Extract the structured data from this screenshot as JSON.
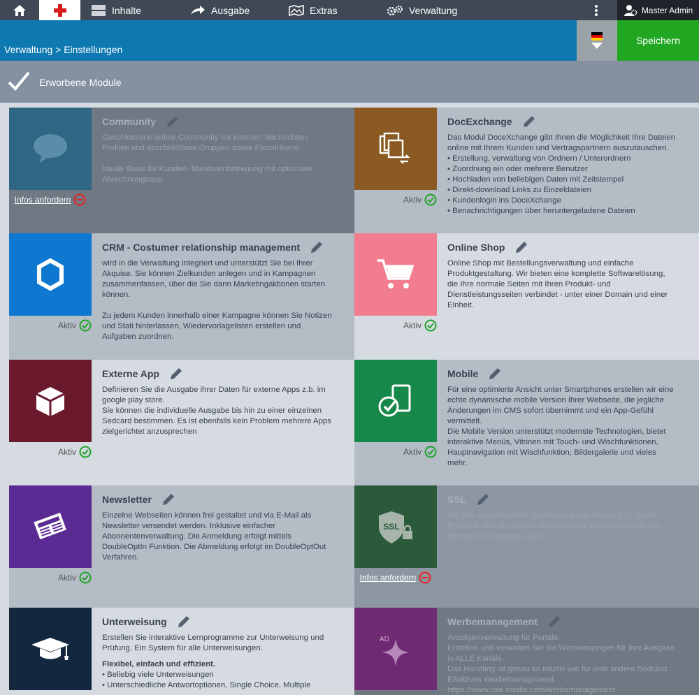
{
  "nav": {
    "inhalte": "Inhalte",
    "ausgabe": "Ausgabe",
    "extras": "Extras",
    "verwaltung": "Verwaltung",
    "admin": "Master Admin"
  },
  "header": {
    "breadcrumb": "Verwaltung > Einstellungen",
    "save_label": "Speichern"
  },
  "section": {
    "title": "Erworbene Module"
  },
  "labels": {
    "aktiv": "Aktiv",
    "infos": "Infos anfordern"
  },
  "colors": {
    "community": "#2f6683",
    "docexchange": "#8a5a22",
    "crm": "#0e78d0",
    "onlineshop": "#f27d8e",
    "externeapp": "#6b1a2e",
    "mobile": "#168849",
    "newsletter": "#5b2b94",
    "ssl": "#2a5a3a",
    "unterweisung": "#13273f",
    "werbemanagement": "#6e2a73"
  },
  "modules": {
    "community": {
      "name": "Community",
      "icon": "chat-bubble-icon",
      "status": "Infos anfordern",
      "desc": "Geschlossene online Community mit internen Nachrichten,\nProfilen und abschließbare Gruppen sowie Einzelräume.\n\nIdeale Basis für Kunden- Mandatenbetreuung mit optionaler\nAbrechnungsapp."
    },
    "docexchange": {
      "name": "DocExchange",
      "icon": "documents-exchange-icon",
      "status": "Aktiv",
      "desc": "Das Modul DoceXchange gibt Ihnen die Möglichkeit Ihre Dateien\nonline mit Ihrem Kunden und Vertragspartnern auszutauschen.\n• Erstellung, verwaltung von Ordnern / Unterordnern\n• Zuordnung ein oder mehrere Benutzer\n• Hochladen von beliebigen Daten mit Zeitstempel\n• Direkt-download Links zu Einzeldateien\n• Kundenlogin ins DoceXchange\n• Benachrichtigungen über heruntergeladene Dateien"
    },
    "crm": {
      "name": "CRM - Costumer relationship management",
      "icon": "hexagon-icon",
      "status": "Aktiv",
      "desc": "wird in die Verwaltung integriert und unterstützt Sie bei Ihrer\nAkquise. Sie können Zielkunden anlegen und in Kampagnen\nzusammenfassen, über die Sie dann Marketingaktionen starten\nkönnen.\n\nZu jedem Kunden innerhalb einer Kampagne können Sie Notizen\nund Stati hinterlassen, Wiedervorlagelisten erstellen und\nAufgaben zuordnen."
    },
    "onlineshop": {
      "name": "Online Shop",
      "icon": "shopping-cart-icon",
      "status": "Aktiv",
      "desc": "Online Shop mit Bestellungsverwaltung und einfache\nProduktgestaltung. Wir bieten eine komplette Softwarelösung,\ndie Ihre normale Seiten mit Ihren Produkt- und\nDienstleistungsseiten verbindet - unter einer Domain und einer\nEinheit."
    },
    "externeapp": {
      "name": "Externe App",
      "icon": "cube-icon",
      "status": "Aktiv",
      "desc": "Definieren Sie die Ausgabe ihrer Daten für externe Apps z.b. im\ngoogle play store.\nSie können die individuelle Ausgabe bis hin zu einer einzelnen\nSedcard bestimmen. Es ist ebenfalls kein Problem mehrere Apps\nzielgerichtet anzusprechen"
    },
    "mobile": {
      "name": "Mobile",
      "icon": "mobile-check-icon",
      "status": "Aktiv",
      "desc": "Für eine optimierte Ansicht unter Smartphones erstellen wir eine\nechte dynamische mobile Version Ihrer Webseite, die jegliche\nÄnderungen im CMS sofort übernimmt und ein App-Gefühl\nvermittelt.\nDie Mobile Version unterstützt modernste Technologien, bietet\ninteraktive Menüs, Vitrinen mit Touch- und Wischfunktionen,\nHauptnavigation mit Wischfunktion, Bildergalerie und vieles\nmehr."
    },
    "newsletter": {
      "name": "Newsletter",
      "icon": "newspaper-icon",
      "status": "Aktiv",
      "desc": "Einzelne Webseiten können frei gestaltet und via E-Mail als\nNewsletter versendet werden. Inklusive einfacher\nAbonnentenverwaltung. Die Anmeldung erfolgt mittels\nDoubleOptIn Funktion. Die Abmeldung erfolgt im DoubleOptOut\nVerfahren."
    },
    "ssl": {
      "name": "SSL",
      "icon": "ssl-shield-icon",
      "status": "Infos anfordern",
      "desc": "Mit SSL verschüsselter Übertragung von Daten. SSL ist ein\nProtokoll, das der Authentifizierung und Verschlüsselung von\nInternetverbindungen dient."
    },
    "unterweisung": {
      "name": "Unterweisung",
      "icon": "graduation-cap-icon",
      "status": "",
      "desc": "Erstellen Sie interaktive Lernprogramme zur Unterweisung und\nPrüfung. Ein System für alle Unterweisungen.",
      "bold": "Flexibel, einfach und effizient.",
      "desc2": "• Beliebig viele Unterweisungen\n• Unterschiedliche Antwortoptionen, Single Choice, Multiple"
    },
    "werbemanagement": {
      "name": "Werbemanagement",
      "icon": "ad-star-icon",
      "status": "",
      "desc": "Anzeigenverwaltung für Portale.\nErstellen und verwalten Sie die Werbeanzeigen für Ihre Ausgabe\nin ALLE Kanäle.\nDas Handling ist genau so intuitiv wie für jede andere Sedcard.\nEffektives Werbemanagement.\nhttps://www.use-media.com/werbemanagement",
      "icon_text": "AD"
    }
  }
}
